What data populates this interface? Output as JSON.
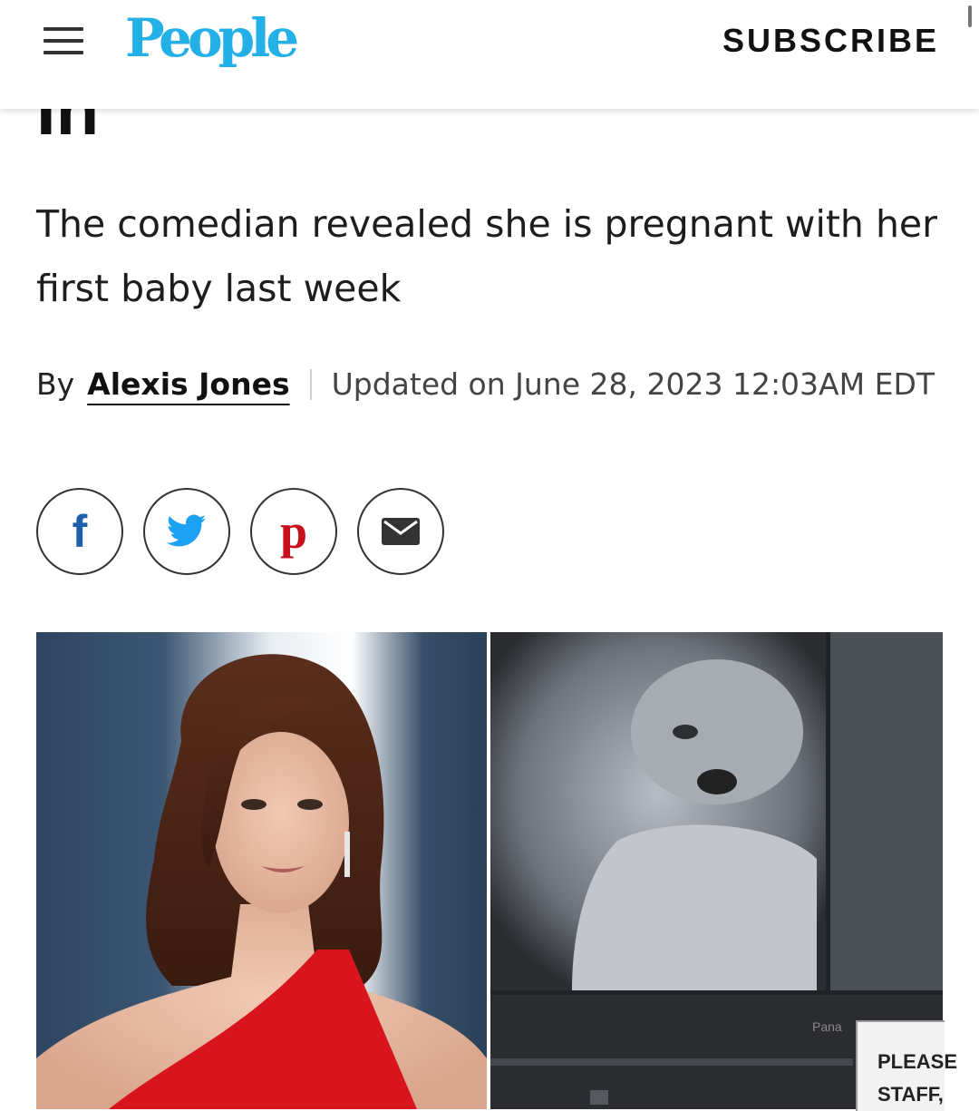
{
  "header": {
    "logo_text": "People",
    "subscribe_label": "SUBSCRIBE"
  },
  "article": {
    "title_fragment": "In",
    "subtitle": "The comedian revealed she is pregnant with her first baby last week",
    "byline_prefix": "By",
    "author": "Alexis Jones",
    "updated": "Updated on June 28, 2023 12:03AM EDT"
  },
  "share": {
    "facebook_glyph": "f",
    "pinterest_glyph": "p"
  },
  "images": {
    "ultrasound_monitor_brand": "Pana",
    "ultrasound_sign_text": "PLEASE\nSTAFF,"
  },
  "colors": {
    "brand": "#23b0e7",
    "facebook": "#1d5fa8",
    "twitter": "#1da1f2",
    "pinterest": "#c6101e",
    "dress_red": "#d8141c"
  }
}
